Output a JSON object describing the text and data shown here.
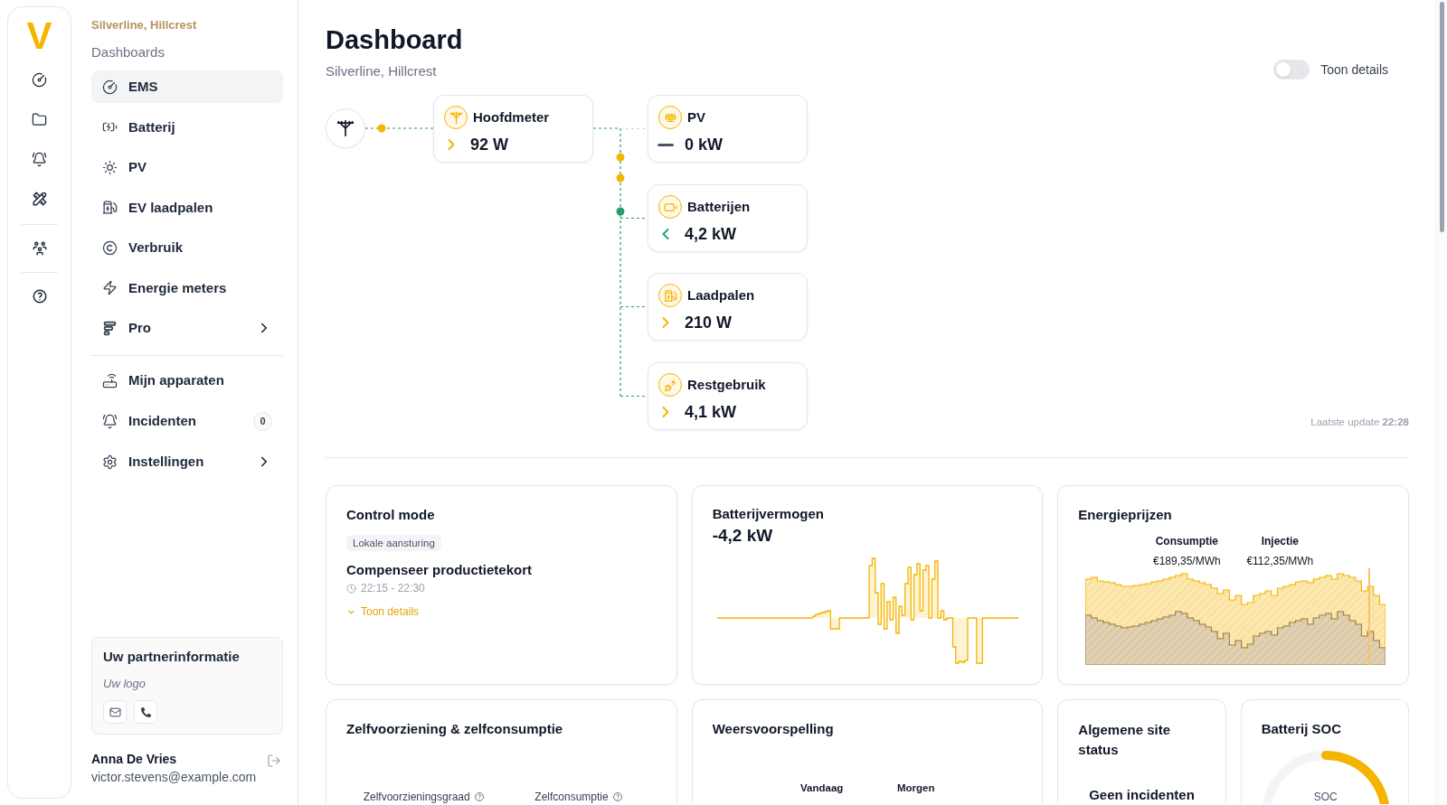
{
  "rail": {
    "logo": "V"
  },
  "sidebar": {
    "site": "Silverline, Hillcrest",
    "section": "Dashboards",
    "items": [
      {
        "label": "EMS",
        "selected": true,
        "submenu": false
      },
      {
        "label": "Batterij",
        "selected": false,
        "submenu": false
      },
      {
        "label": "PV",
        "selected": false,
        "submenu": false
      },
      {
        "label": "EV laadpalen",
        "selected": false,
        "submenu": false
      },
      {
        "label": "Verbruik",
        "selected": false,
        "submenu": false
      },
      {
        "label": "Energie meters",
        "selected": false,
        "submenu": false
      },
      {
        "label": "Pro",
        "selected": false,
        "submenu": true
      }
    ],
    "items_2": [
      {
        "label": "Mijn apparaten",
        "selected": false,
        "submenu": false
      },
      {
        "label": "Incidenten",
        "selected": false,
        "submenu": false,
        "badge": "0"
      },
      {
        "label": "Instellingen",
        "selected": false,
        "submenu": true
      }
    ],
    "partner": {
      "title": "Uw partnerinformatie",
      "logo_note": "Uw logo"
    },
    "user": {
      "name": "Anna De Vries",
      "email": "victor.stevens@example.com"
    }
  },
  "header": {
    "title": "Dashboard",
    "subtitle": "Silverline, Hillcrest",
    "details_toggle": {
      "label": "Toon details",
      "on": false
    }
  },
  "flow_diagram": {
    "meter": {
      "label": "Hoofdmeter",
      "value": "92 W",
      "kind": "out"
    },
    "branches": [
      {
        "label": "PV",
        "value": "0 kW",
        "kind": "none"
      },
      {
        "label": "Batterijen",
        "value": "4,2 kW",
        "kind": "in"
      },
      {
        "label": "Laadpalen",
        "value": "210 W",
        "kind": "out"
      },
      {
        "label": "Restgebruik",
        "value": "4,1 kW",
        "kind": "out"
      }
    ],
    "last_update": "Laatste update **22:28**"
  },
  "control_mode": {
    "title": "Control mode",
    "tag": "Lokale aansturing",
    "mode": "Compenseer productietekort",
    "time": "22:15 - 22:30",
    "details_link": "Toon details"
  },
  "battery_power": {
    "title": "Batterijvermogen",
    "value": "-4,2 kW"
  },
  "energy_prices": {
    "title": "Energieprijzen",
    "legend": [
      {
        "label": "Consumptie",
        "value": "€189,35/MWh"
      },
      {
        "label": "Injectie",
        "value": "€112,35/MWh"
      }
    ]
  },
  "self_sufficiency": {
    "title": "Zelfvoorziening & zelfconsumptie",
    "metrics": [
      {
        "label": "Zelfvoorzieningsgraad"
      },
      {
        "label": "Zelfconsumptie"
      }
    ]
  },
  "weather": {
    "title": "Weersvoorspelling",
    "days": [
      {
        "label": "Vandaag"
      },
      {
        "label": "Morgen"
      }
    ]
  },
  "site_status": {
    "title": "Algemene site status",
    "status": "Geen incidenten"
  },
  "battery_soc": {
    "title": "Batterij SOC",
    "label": "SOC"
  }
}
